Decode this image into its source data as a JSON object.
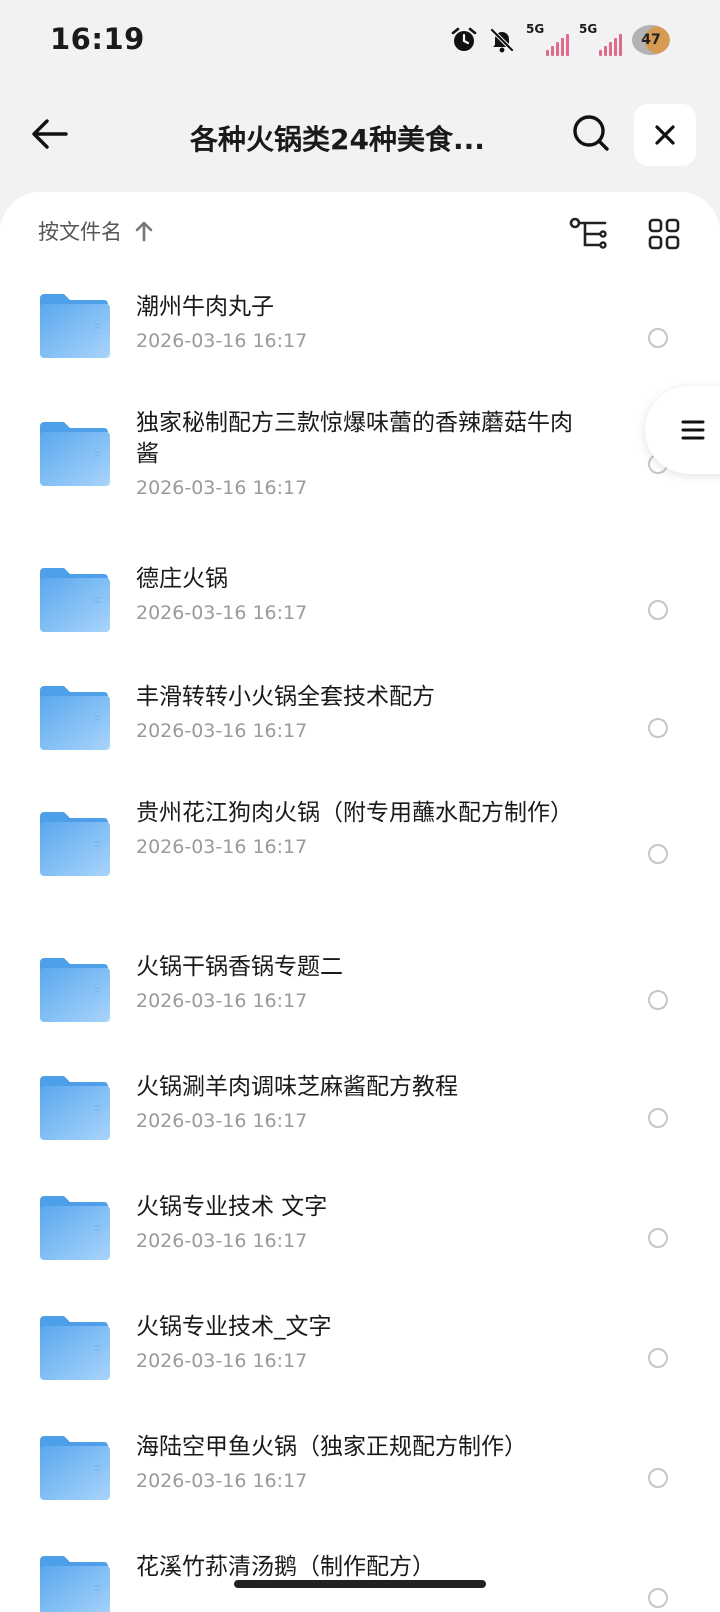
{
  "status_bar": {
    "time": "16:19",
    "network1": "5G",
    "network2": "5G",
    "battery": "47"
  },
  "header": {
    "title": "各种火锅类24种美食..."
  },
  "sort": {
    "label": "按文件名"
  },
  "files": [
    {
      "name": "潮州牛肉丸子",
      "date": "2026-03-16 16:17"
    },
    {
      "name": "独家秘制配方三款惊爆味蕾的香辣蘑菇牛肉酱",
      "date": "2026-03-16 16:17"
    },
    {
      "name": "德庄火锅",
      "date": "2026-03-16 16:17"
    },
    {
      "name": "丰滑转转小火锅全套技术配方",
      "date": "2026-03-16 16:17"
    },
    {
      "name": "贵州花江狗肉火锅（附专用蘸水配方制作）",
      "date": "2026-03-16 16:17"
    },
    {
      "name": "火锅干锅香锅专题二",
      "date": "2026-03-16 16:17"
    },
    {
      "name": "火锅涮羊肉调味芝麻酱配方教程",
      "date": "2026-03-16 16:17"
    },
    {
      "name": "火锅专业技术 文字",
      "date": "2026-03-16 16:17"
    },
    {
      "name": "火锅专业技术_文字",
      "date": "2026-03-16 16:17"
    },
    {
      "name": "海陆空甲鱼火锅（独家正规配方制作）",
      "date": "2026-03-16 16:17"
    },
    {
      "name": "花溪竹荪清汤鹅（制作配方）",
      "date": ""
    }
  ],
  "colors": {
    "folder_top": "#5aa8ee",
    "folder_bottom": "#a9d4fb",
    "signal": "#e06a8a"
  }
}
